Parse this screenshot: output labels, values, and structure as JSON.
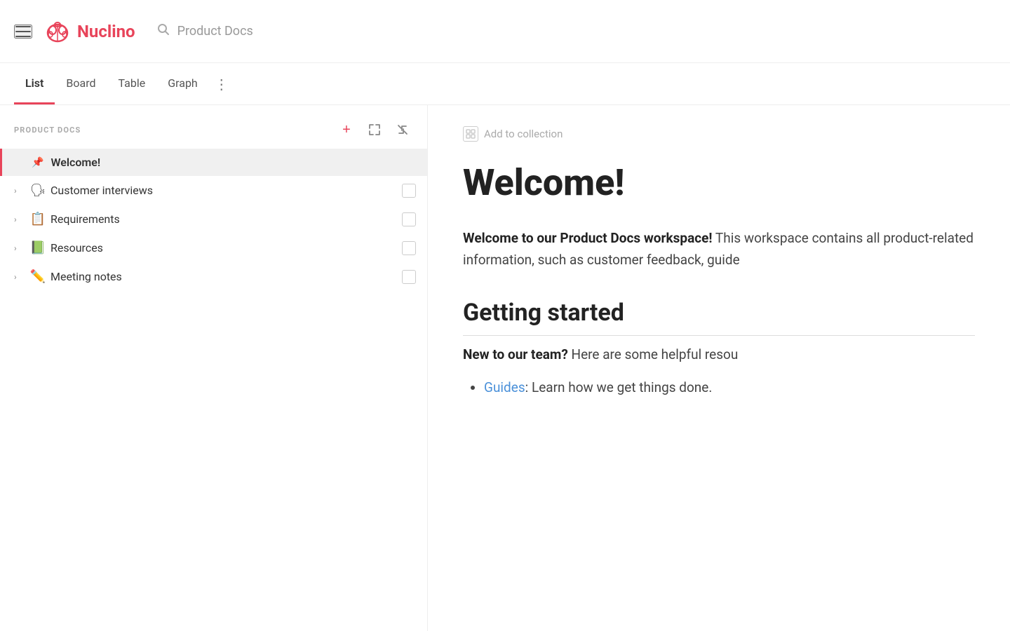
{
  "header": {
    "hamburger_label": "menu",
    "logo_text": "Nuclino",
    "search_placeholder": "Product Docs"
  },
  "tabs": {
    "items": [
      {
        "id": "list",
        "label": "List",
        "active": true
      },
      {
        "id": "board",
        "label": "Board",
        "active": false
      },
      {
        "id": "table",
        "label": "Table",
        "active": false
      },
      {
        "id": "graph",
        "label": "Graph",
        "active": false
      }
    ],
    "more_label": "⋮"
  },
  "sidebar": {
    "title": "PRODUCT DOCS",
    "add_btn": "+",
    "expand_btn": "⤢",
    "collapse_btn": "«",
    "items": [
      {
        "id": "welcome",
        "emoji": "📌",
        "label": "Welcome!",
        "active": true,
        "has_chevron": false,
        "has_checkbox": false
      },
      {
        "id": "customer-interviews",
        "emoji": "🗣",
        "label": "Customer interviews",
        "active": false,
        "has_chevron": true,
        "has_checkbox": true
      },
      {
        "id": "requirements",
        "emoji": "📋",
        "label": "Requirements",
        "active": false,
        "has_chevron": true,
        "has_checkbox": true
      },
      {
        "id": "resources",
        "emoji": "📗",
        "label": "Resources",
        "active": false,
        "has_chevron": true,
        "has_checkbox": true
      },
      {
        "id": "meeting-notes",
        "emoji": "✏️",
        "label": "Meeting notes",
        "active": false,
        "has_chevron": true,
        "has_checkbox": true
      }
    ]
  },
  "content": {
    "add_to_collection": "Add to collection",
    "title": "Welcome!",
    "paragraph1_bold": "Welcome to our Product Docs workspace!",
    "paragraph1_rest": " This workspace contains all product-related information, such as customer feedback, guide",
    "section1_title": "Getting started",
    "subsection1_bold": "New to our team?",
    "subsection1_rest": " Here are some helpful resou",
    "list_items": [
      {
        "link": "Guides",
        "rest": ": Learn how we get things done."
      }
    ]
  }
}
